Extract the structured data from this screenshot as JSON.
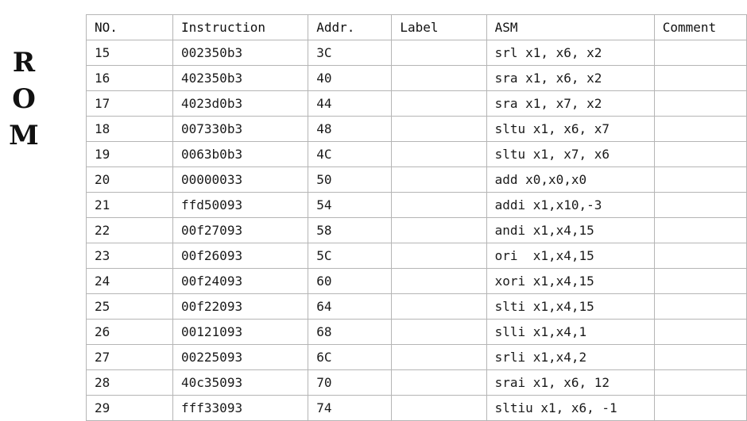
{
  "side_title": [
    "R",
    "O",
    "M"
  ],
  "table": {
    "headers": [
      "NO.",
      "Instruction",
      "Addr.",
      "Label",
      "ASM",
      "Comment"
    ],
    "rows": [
      [
        "15",
        "002350b3",
        "3C",
        "",
        "srl x1, x6, x2",
        ""
      ],
      [
        "16",
        "402350b3",
        "40",
        "",
        "sra x1, x6, x2",
        ""
      ],
      [
        "17",
        "4023d0b3",
        "44",
        "",
        "sra x1, x7, x2",
        ""
      ],
      [
        "18",
        "007330b3",
        "48",
        "",
        "sltu x1, x6, x7",
        ""
      ],
      [
        "19",
        "0063b0b3",
        "4C",
        "",
        "sltu x1, x7, x6",
        ""
      ],
      [
        "20",
        "00000033",
        "50",
        "",
        "add x0,x0,x0",
        ""
      ],
      [
        "21",
        "ffd50093",
        "54",
        "",
        "addi x1,x10,-3",
        ""
      ],
      [
        "22",
        "00f27093",
        "58",
        "",
        "andi x1,x4,15",
        ""
      ],
      [
        "23",
        "00f26093",
        "5C",
        "",
        "ori  x1,x4,15",
        ""
      ],
      [
        "24",
        "00f24093",
        "60",
        "",
        "xori x1,x4,15",
        ""
      ],
      [
        "25",
        "00f22093",
        "64",
        "",
        "slti x1,x4,15",
        ""
      ],
      [
        "26",
        "00121093",
        "68",
        "",
        "slli x1,x4,1",
        ""
      ],
      [
        "27",
        "00225093",
        "6C",
        "",
        "srli x1,x4,2",
        ""
      ],
      [
        "28",
        "40c35093",
        "70",
        "",
        "srai x1, x6, 12",
        ""
      ],
      [
        "29",
        "fff33093",
        "74",
        "",
        "sltiu x1, x6, -1",
        ""
      ]
    ]
  }
}
